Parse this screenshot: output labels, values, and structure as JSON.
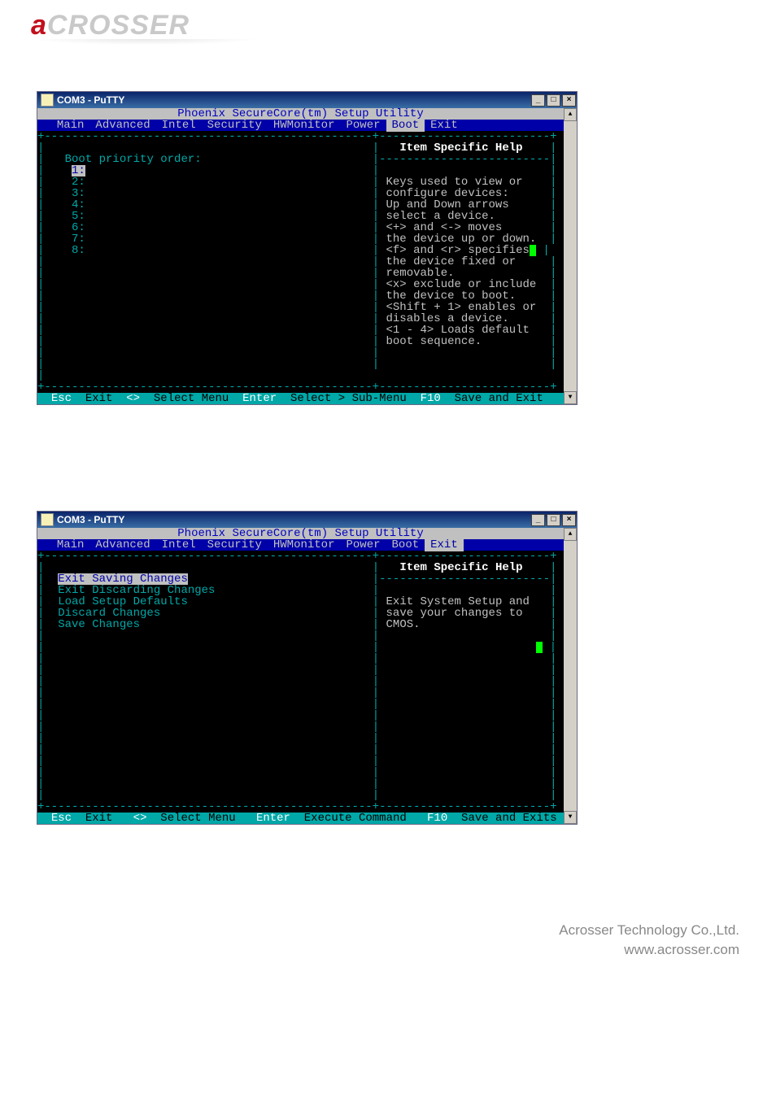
{
  "logo": {
    "first": "a",
    "rest": "CROSSER"
  },
  "footer_company": "Acrosser Technology Co.,Ltd.",
  "footer_url": "www.acrosser.com",
  "win1": {
    "title": "COM3 - PuTTY",
    "utility": "Phoenix SecureCore(tm) Setup Utility",
    "menu": [
      "Main",
      "Advanced",
      "Intel",
      "Security",
      "HWMonitor",
      "Power",
      "Boot",
      "Exit"
    ],
    "selected_menu": "Boot",
    "left_heading": "Boot priority order:",
    "left_items": [
      "1:",
      "2:",
      "3:",
      "4:",
      "5:",
      "6:",
      "7:",
      "8:"
    ],
    "help_title": "Item Specific Help",
    "help_lines": [
      "Keys used to view or",
      "configure devices:",
      "Up and Down arrows",
      "select a device.",
      "<+> and <-> moves",
      "the device up or down.",
      "<f> and <r> specifies",
      "the device fixed or",
      "removable.",
      "<x> exclude or include",
      "the device to boot.",
      "<Shift + 1> enables or",
      "disables a device.",
      "<1 - 4> Loads default",
      "boot sequence."
    ],
    "foot": {
      "k1": "Esc",
      "v1": "Exit",
      "k2": "<>",
      "v2": "Select Menu",
      "k3": "Enter",
      "v3": "Select > Sub-Menu",
      "k4": "F10",
      "v4": "Save and Exit"
    }
  },
  "win2": {
    "title": "COM3 - PuTTY",
    "utility": "Phoenix SecureCore(tm) Setup Utility",
    "menu": [
      "Main",
      "Advanced",
      "Intel",
      "Security",
      "HWMonitor",
      "Power",
      "Boot",
      "Exit"
    ],
    "selected_menu": "Exit",
    "left_items": [
      "Exit Saving Changes",
      "Exit Discarding Changes",
      "Load Setup Defaults",
      "Discard Changes",
      "Save Changes"
    ],
    "help_title": "Item Specific Help",
    "help_lines": [
      "Exit System Setup and",
      "save your changes to",
      "CMOS."
    ],
    "foot": {
      "k1": "Esc",
      "v1": "Exit",
      "k2": "<>",
      "v2": "Select Menu",
      "k3": "Enter",
      "v3": "Execute Command",
      "k4": "F10",
      "v4": "Save and Exits"
    }
  }
}
